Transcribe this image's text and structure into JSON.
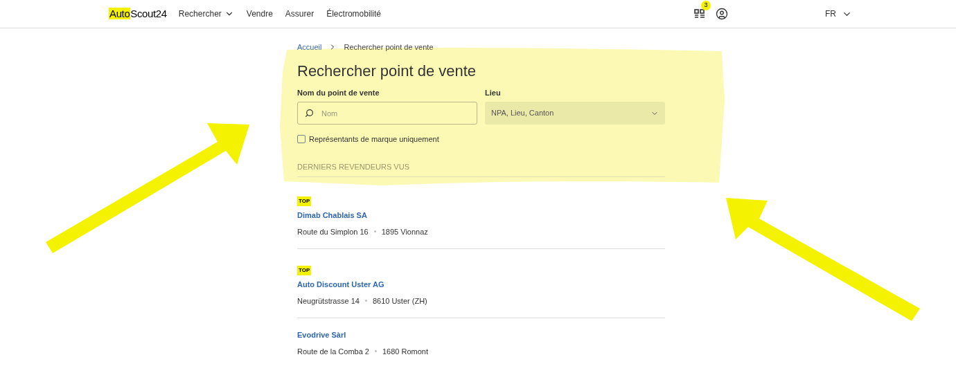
{
  "header": {
    "logo": {
      "highlighted": "Auto",
      "rest": "Scout24"
    },
    "nav": [
      {
        "label": "Rechercher",
        "has_menu": true
      },
      {
        "label": "Vendre",
        "has_menu": false
      },
      {
        "label": "Assurer",
        "has_menu": false
      },
      {
        "label": "Électromobilité",
        "has_menu": false
      }
    ],
    "compare_badge": "3",
    "language": "FR"
  },
  "breadcrumb": [
    {
      "label": "Accueil",
      "link": true
    },
    {
      "label": "Rechercher point de vente",
      "link": false
    }
  ],
  "title": "Rechercher point de vente",
  "name_field": {
    "label": "Nom du point de vente",
    "placeholder": "Nom"
  },
  "location_field": {
    "label": "Lieu",
    "placeholder": "NPA, Lieu, Canton"
  },
  "brand_checkbox": {
    "label": "Représentants de marque uniquement",
    "checked": false
  },
  "recent_heading": "DERNIERS REVENDEURS VUS",
  "dealers": [
    {
      "badge": "TOP",
      "name": "Dimab Chablais SA",
      "street": "Route du Simplon 16",
      "city": "1895 Vionnaz"
    },
    {
      "badge": "TOP",
      "name": "Auto Discount Uster AG",
      "street": "Neugrütstrasse 14",
      "city": "8610 Uster (ZH)"
    },
    {
      "name": "Evodrive Sàrl",
      "street": "Route de la Comba 2",
      "city": "1680 Romont"
    }
  ]
}
